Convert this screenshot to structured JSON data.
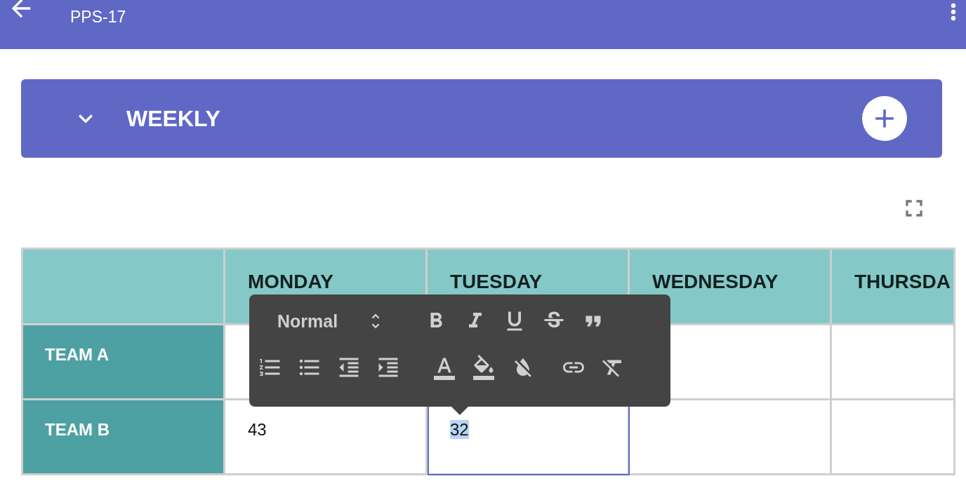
{
  "app_bar": {
    "subtitle": "PPS-17"
  },
  "section": {
    "title": "WEEKLY",
    "expanded": true
  },
  "table": {
    "columns": [
      "MONDAY",
      "TUESDAY",
      "WEDNESDAY",
      "THURSDA"
    ],
    "rows": [
      {
        "team": "TEAM A",
        "cells": [
          {
            "selected": false
          },
          null,
          {
            "selected": false
          },
          {
            "selected": false
          }
        ]
      },
      {
        "team": "TEAM B",
        "cells": [
          {
            "value": "43",
            "selected": false
          },
          {
            "value": "32",
            "selected": true
          },
          {
            "selected": false
          },
          {
            "selected": false
          }
        ]
      }
    ]
  },
  "format_toolbar": {
    "format": "Normal"
  }
}
